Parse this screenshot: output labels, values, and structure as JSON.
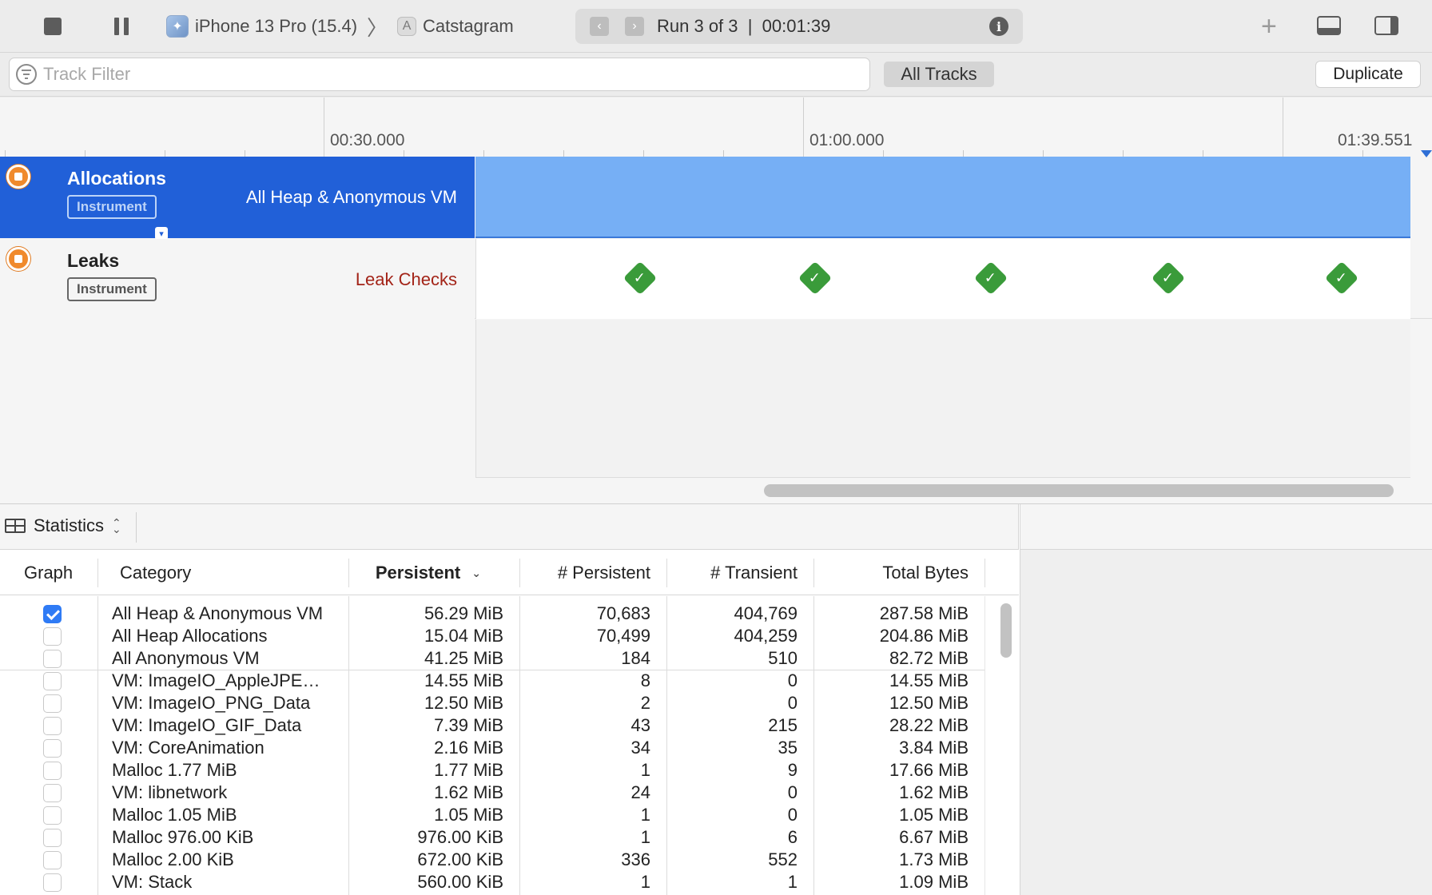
{
  "toolbar": {
    "device": "iPhone 13 Pro (15.4)",
    "app": "Catstagram",
    "breadcrumb_sep": "〉",
    "run_label": "Run 3 of 3  |  00:01:39",
    "info_glyph": "i",
    "plus_glyph": "+",
    "prev_glyph": "‹",
    "next_glyph": "›"
  },
  "filter": {
    "placeholder": "Track Filter",
    "scope": "All Tracks",
    "duplicate_label": "Duplicate"
  },
  "ruler": {
    "labels": [
      "00:30.000",
      "01:00.000",
      "01:39.551"
    ]
  },
  "tracks": {
    "allocations": {
      "name": "Allocations",
      "badge": "Instrument",
      "subtitle": "All Heap & Anonymous VM",
      "color": "#2160d8"
    },
    "leaks": {
      "name": "Leaks",
      "badge": "Instrument",
      "subtitle": "Leak Checks",
      "check_glyph": "✓",
      "check_count": 5,
      "check_color": "#3a9b3a"
    }
  },
  "detail": {
    "view_selector": "Statistics",
    "columns": {
      "graph": "Graph",
      "category": "Category",
      "persistent": "Persistent",
      "num_persistent": "# Persistent",
      "num_transient": "# Transient",
      "total_bytes": "Total Bytes"
    },
    "rows": [
      {
        "checked": true,
        "category": "All Heap & Anonymous VM",
        "persistent": "56.29 MiB",
        "num_persistent": "70,683",
        "num_transient": "404,769",
        "total_bytes": "287.58 MiB"
      },
      {
        "checked": false,
        "category": "All Heap Allocations",
        "persistent": "15.04 MiB",
        "num_persistent": "70,499",
        "num_transient": "404,259",
        "total_bytes": "204.86 MiB"
      },
      {
        "checked": false,
        "category": "All Anonymous VM",
        "persistent": "41.25 MiB",
        "num_persistent": "184",
        "num_transient": "510",
        "total_bytes": "82.72 MiB"
      },
      {
        "checked": false,
        "category": "VM: ImageIO_AppleJPE…",
        "persistent": "14.55 MiB",
        "num_persistent": "8",
        "num_transient": "0",
        "total_bytes": "14.55 MiB"
      },
      {
        "checked": false,
        "category": "VM: ImageIO_PNG_Data",
        "persistent": "12.50 MiB",
        "num_persistent": "2",
        "num_transient": "0",
        "total_bytes": "12.50 MiB"
      },
      {
        "checked": false,
        "category": "VM: ImageIO_GIF_Data",
        "persistent": "7.39 MiB",
        "num_persistent": "43",
        "num_transient": "215",
        "total_bytes": "28.22 MiB"
      },
      {
        "checked": false,
        "category": "VM: CoreAnimation",
        "persistent": "2.16 MiB",
        "num_persistent": "34",
        "num_transient": "35",
        "total_bytes": "3.84 MiB"
      },
      {
        "checked": false,
        "category": "Malloc 1.77 MiB",
        "persistent": "1.77 MiB",
        "num_persistent": "1",
        "num_transient": "9",
        "total_bytes": "17.66 MiB"
      },
      {
        "checked": false,
        "category": "VM: libnetwork",
        "persistent": "1.62 MiB",
        "num_persistent": "24",
        "num_transient": "0",
        "total_bytes": "1.62 MiB"
      },
      {
        "checked": false,
        "category": "Malloc 1.05 MiB",
        "persistent": "1.05 MiB",
        "num_persistent": "1",
        "num_transient": "0",
        "total_bytes": "1.05 MiB"
      },
      {
        "checked": false,
        "category": "Malloc 976.00 KiB",
        "persistent": "976.00 KiB",
        "num_persistent": "1",
        "num_transient": "6",
        "total_bytes": "6.67 MiB"
      },
      {
        "checked": false,
        "category": "Malloc 2.00 KiB",
        "persistent": "672.00 KiB",
        "num_persistent": "336",
        "num_transient": "552",
        "total_bytes": "1.73 MiB"
      },
      {
        "checked": false,
        "category": "VM: Stack",
        "persistent": "560.00 KiB",
        "num_persistent": "1",
        "num_transient": "1",
        "total_bytes": "1.09 MiB"
      }
    ]
  }
}
